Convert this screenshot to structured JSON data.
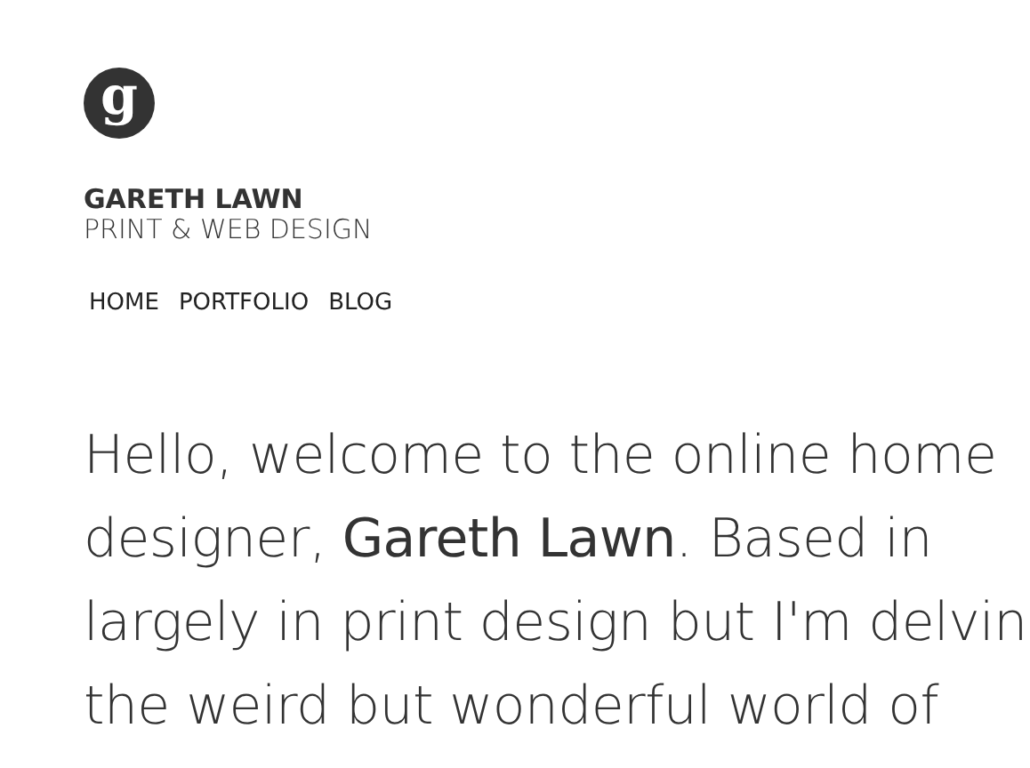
{
  "logo": {
    "letter": "g"
  },
  "site_title": "GARETH LAWN",
  "site_tagline": "PRINT & WEB DESIGN",
  "nav": [
    {
      "label": "HOME"
    },
    {
      "label": "PORTFOLIO"
    },
    {
      "label": "BLOG"
    }
  ],
  "intro_lines": [
    "Hello, welcome to the online home",
    "designer, **Gareth Lawn**. Based in",
    "largely in print design but I'm delvin",
    "the weird but wonderful world of"
  ]
}
